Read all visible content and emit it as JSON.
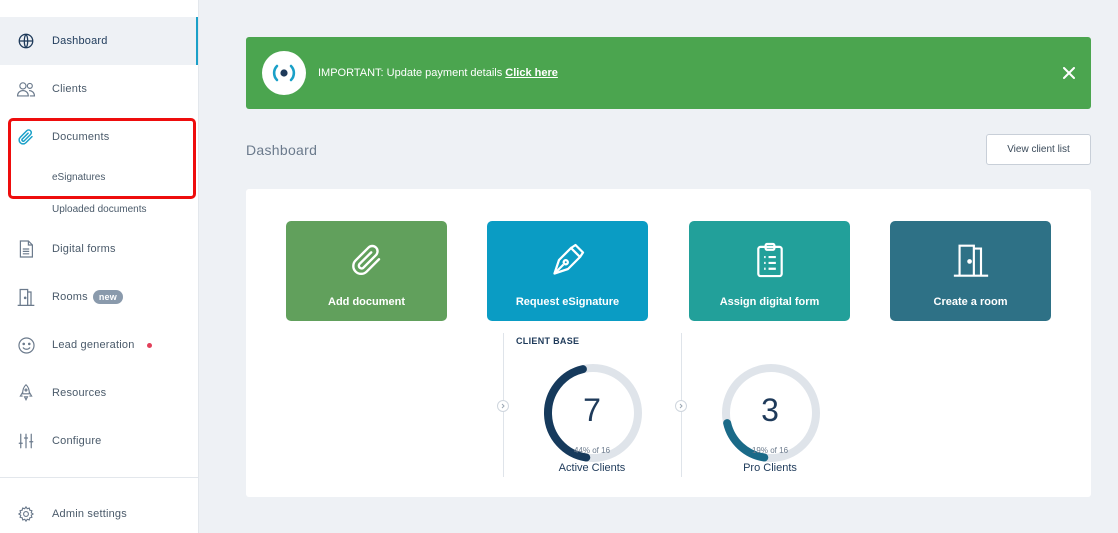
{
  "sidebar": {
    "items": [
      {
        "label": "Dashboard",
        "icon": "globe-icon"
      },
      {
        "label": "Clients",
        "icon": "users-icon"
      },
      {
        "label": "Documents",
        "icon": "paperclip-icon"
      },
      {
        "label": "Digital forms",
        "icon": "file-text-icon"
      },
      {
        "label": "Rooms",
        "icon": "building-icon",
        "badge": "new"
      },
      {
        "label": "Lead generation",
        "icon": "smiley-icon"
      },
      {
        "label": "Resources",
        "icon": "rocket-icon"
      },
      {
        "label": "Configure",
        "icon": "sliders-icon"
      }
    ],
    "documents_sub": [
      "eSignatures",
      "Uploaded documents"
    ],
    "admin": {
      "label": "Admin settings",
      "icon": "gear-icon"
    }
  },
  "banner": {
    "text": "IMPORTANT: Update payment details",
    "link": "Click here",
    "color": "#4ba54f"
  },
  "header": {
    "title": "Dashboard",
    "button": "View client list"
  },
  "tiles": [
    {
      "label": "Add document",
      "icon": "paperclip-icon",
      "color": "#61a05c"
    },
    {
      "label": "Request eSignature",
      "icon": "pen-nib-icon",
      "color": "#0a9cc4"
    },
    {
      "label": "Assign digital form",
      "icon": "clipboard-icon",
      "color": "#22a09a"
    },
    {
      "label": "Create a room",
      "icon": "door-icon",
      "color": "#2e7186"
    }
  ],
  "client_base": {
    "section_label": "CLIENT BASE",
    "gauges": [
      {
        "value": "7",
        "sub": "44% of 16",
        "label": "Active Clients",
        "fraction": 0.44
      },
      {
        "value": "3",
        "sub": "19% of 16",
        "label": "Pro Clients",
        "fraction": 0.19
      }
    ]
  }
}
